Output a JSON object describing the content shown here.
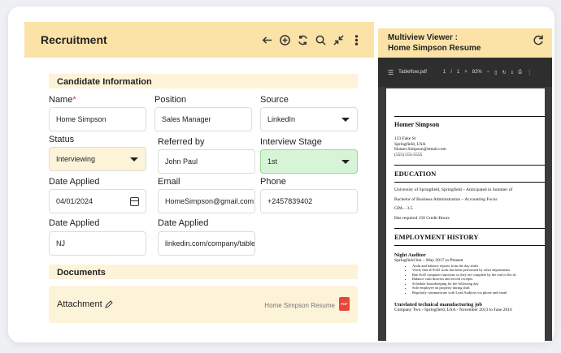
{
  "form": {
    "title": "Recruitment",
    "section_candidate": "Candidate Information",
    "name_label": "Name",
    "name_required_mark": "*",
    "name_value": "Home Simpson",
    "position_label": "Position",
    "position_value": "Sales Manager",
    "source_label": "Source",
    "source_value": "LinkedIn",
    "status_label": "Status",
    "status_value": "Interviewing",
    "referred_label": "Referred by",
    "referred_value": "John Paul",
    "stage_label": "Interview Stage",
    "stage_value": "1st",
    "date_applied_label": "Date Applied",
    "date_applied_value": "04/01/2024",
    "email_label": "Email",
    "email_value": "HomeSimpson@gmail.com",
    "phone_label": "Phone",
    "phone_value": "+2457839402",
    "date_applied2_label": "Date Applied",
    "date_applied2_value": "NJ",
    "date_applied3_label": "Date Applied",
    "date_applied3_value": "linkedin.com/company/tableflow",
    "section_documents": "Documents",
    "attachment_label": "Attachment",
    "attachment_file": "Home Simpson Resume",
    "pdf_badge": "PDF"
  },
  "viewer": {
    "title_line1": "Multiview Viewer :",
    "title_line2": "Home Simpson Resume",
    "toolbar": {
      "filename": "Tableflow.pdf",
      "page_current": "1",
      "page_sep": "/",
      "page_total": "1",
      "zoom": "82%"
    },
    "resume": {
      "name": "Homer Simpson",
      "addr1": "123 Fake St",
      "addr2": "Springfield, USA",
      "email": "Homer.Simpson@email.com",
      "phone": "(555) 555-5555",
      "education_heading": "EDUCATION",
      "edu1": "University of Springfield, Springfield – Anticipated in Summer of",
      "edu2": "Bachelor of Business Administration – Accounting Focus",
      "edu3": "GPA – 3.5",
      "edu4": "Has required 150 Credit Hours",
      "employment_heading": "EMPLOYMENT HISTORY",
      "job1_title": "Night Auditor",
      "job1_place": "Springfield Inn – May 2017 to Present",
      "job1_bullets": [
        "Audit and balance reports from the day shifts",
        "Verify that all EoD work has been performed by other departments",
        "Run EoD computer functions so they are complete by the end of the sh",
        "Balance cash drawers and record receipts",
        "Schedule housekeeping for the following day",
        "Sole employee on property during shift",
        "Regularly communicate with Lead Auditors via phone and email"
      ],
      "job2_title": "Unrelated technical manufacturing job",
      "job2_place": "Company Two - Springfield, USA - November 2013 to June 2016"
    }
  }
}
